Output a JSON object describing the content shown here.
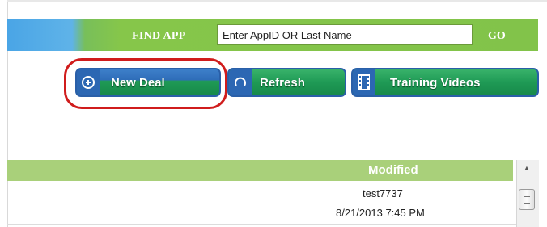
{
  "find": {
    "label": "FIND APP",
    "placeholder": "Enter AppID OR Last Name",
    "go": "GO"
  },
  "toolbar": {
    "new_deal": "New Deal",
    "refresh": "Refresh",
    "training": "Training Videos"
  },
  "grid": {
    "columns": [
      "Modified"
    ],
    "rows": [
      {
        "modified_by": "test7737",
        "modified_at": "8/21/2013 7:45 PM"
      }
    ]
  },
  "colors": {
    "find_bar_green": "#82c34a",
    "button_green": "#1f9a55",
    "button_border_blue": "#2a5fa8",
    "header_green": "#a9d07a",
    "highlight_red": "#d01c1c"
  }
}
